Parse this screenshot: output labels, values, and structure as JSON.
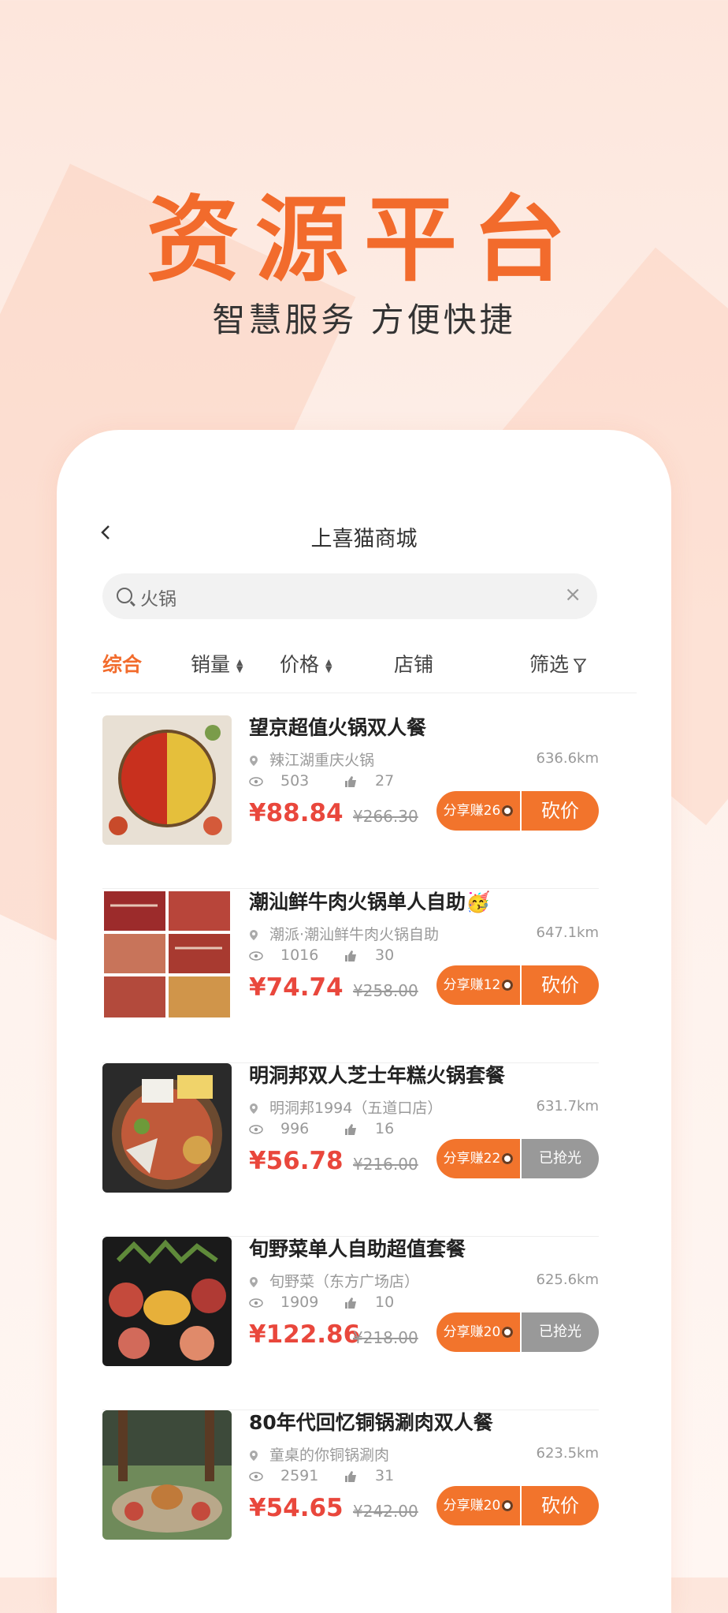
{
  "hero": {
    "title": "资源平台",
    "subtitle": "智慧服务  方便快捷"
  },
  "header": {
    "title": "上喜猫商城"
  },
  "search": {
    "value": "火锅",
    "clear": "×"
  },
  "filters": [
    {
      "label": "综合",
      "active": true
    },
    {
      "label": "销量",
      "active": false
    },
    {
      "label": "价格",
      "active": false
    },
    {
      "label": "店铺",
      "active": false
    },
    {
      "label": "筛选",
      "active": false
    }
  ],
  "items": [
    {
      "name": "望京超值火锅双人餐",
      "shop": "辣江湖重庆火锅",
      "distance": "636.6km",
      "views": "503",
      "likes": "27",
      "price": "¥88.84",
      "old_price": "¥266.30",
      "share": "分享赚26",
      "action": "砍价"
    },
    {
      "name": "潮汕鲜牛肉火锅单人自助🥳",
      "shop": "潮派·潮汕鲜牛肉火锅自助",
      "distance": "647.1km",
      "views": "1016",
      "likes": "30",
      "price": "¥74.74",
      "old_price": "¥258.00",
      "share": "分享赚12",
      "action": "砍价"
    },
    {
      "name": "明洞邦双人芝士年糕火锅套餐",
      "shop": "明洞邦1994（五道口店）",
      "distance": "631.7km",
      "views": "996",
      "likes": "16",
      "price": "¥56.78",
      "old_price": "¥216.00",
      "share": "分享赚22",
      "action": "已抢光"
    },
    {
      "name": "旬野菜单人自助超值套餐",
      "shop": "旬野菜（东方广场店）",
      "distance": "625.6km",
      "views": "1909",
      "likes": "10",
      "price": "¥122.86",
      "old_price": "¥218.00",
      "share": "分享赚20",
      "action": "已抢光"
    },
    {
      "name": "80年代回忆铜锅涮肉双人餐",
      "shop": "童桌的你铜锅涮肉",
      "distance": "623.5km",
      "views": "2591",
      "likes": "31",
      "price": "¥54.65",
      "old_price": "¥242.00",
      "share": "分享赚20",
      "action": "砍价"
    }
  ],
  "colors": {
    "accent": "#f26b2c",
    "price": "#e9473c",
    "soldout": "#999999"
  }
}
